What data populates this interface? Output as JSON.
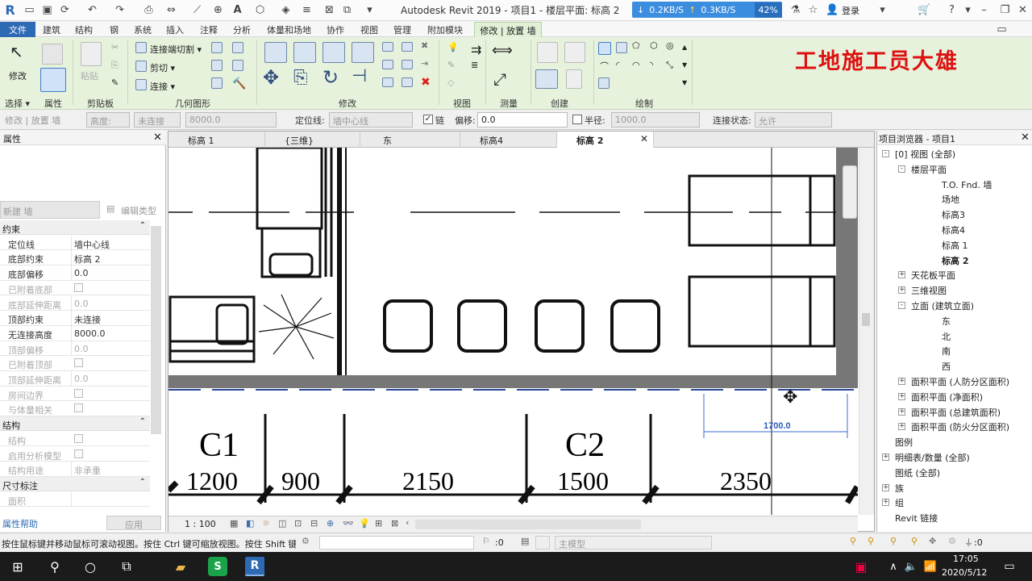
{
  "title_bar": {
    "title": "Autodesk Revit 2019 - 项目1 - 楼层平面: 标高 2",
    "net_down": "0.2KB/S",
    "net_up": "0.3KB/S",
    "net_pct": "42%",
    "login": "登录"
  },
  "menu": {
    "file": "文件",
    "items": [
      "建筑",
      "结构",
      "钢",
      "系统",
      "插入",
      "注释",
      "分析",
      "体量和场地",
      "协作",
      "视图",
      "管理",
      "附加模块",
      "修改 | 放置 墙"
    ]
  },
  "ribbon": {
    "watermark": "工地施工员大雄",
    "modify": "修改",
    "select": "选择 ▾",
    "properties": "属性",
    "paste": "粘贴",
    "clipboard": "剪贴板",
    "join_cut": "连接端切割 ▾",
    "cut": "剪切 ▾",
    "join": "连接 ▾",
    "geometry": "几何图形",
    "modify_panel": "修改",
    "view_panel": "视图",
    "measure_panel": "测量",
    "create_panel": "创建",
    "draw_panel": "绘制"
  },
  "options": {
    "label1": "修改 | 放置 墙",
    "height": "高度:",
    "unconnected": "未连接",
    "height_value": "8000.0",
    "locline_label": "定位线:",
    "locline_value": "墙中心线",
    "chain_label": "链",
    "offset_label": "偏移:",
    "offset_value": "0.0",
    "radius_label": "半径:",
    "radius_value": "1000.0",
    "join_status_label": "连接状态:",
    "join_status_value": "允许"
  },
  "properties": {
    "title": "属性",
    "type_selector": "新建 墙",
    "edit_type": "编辑类型",
    "sections": [
      {
        "name": "约束",
        "rows": [
          {
            "k": "定位线",
            "v": "墙中心线",
            "dis": false
          },
          {
            "k": "底部约束",
            "v": "标高 2",
            "dis": false
          },
          {
            "k": "底部偏移",
            "v": "0.0",
            "dis": false
          },
          {
            "k": "已附着底部",
            "v": "",
            "dis": true,
            "cb": true
          },
          {
            "k": "底部延伸距离",
            "v": "0.0",
            "dis": true
          },
          {
            "k": "顶部约束",
            "v": "未连接",
            "dis": false
          },
          {
            "k": "无连接高度",
            "v": "8000.0",
            "dis": false
          },
          {
            "k": "顶部偏移",
            "v": "0.0",
            "dis": true
          },
          {
            "k": "已附着顶部",
            "v": "",
            "dis": true,
            "cb": true
          },
          {
            "k": "顶部延伸距离",
            "v": "0.0",
            "dis": true
          },
          {
            "k": "房间边界",
            "v": "",
            "dis": true,
            "cb": true
          },
          {
            "k": "与体量相关",
            "v": "",
            "dis": true,
            "cb": true
          }
        ]
      },
      {
        "name": "结构",
        "rows": [
          {
            "k": "结构",
            "v": "",
            "dis": true,
            "cb": true
          },
          {
            "k": "启用分析模型",
            "v": "",
            "dis": true,
            "cb": true
          },
          {
            "k": "结构用途",
            "v": "非承重",
            "dis": true
          }
        ]
      },
      {
        "name": "尺寸标注",
        "rows": [
          {
            "k": "面积",
            "v": "",
            "dis": true
          }
        ]
      }
    ],
    "help": "属性帮助",
    "apply": "应用"
  },
  "view_tabs": [
    "标高 1",
    "{三维}",
    "东",
    "标高4",
    "标高 2"
  ],
  "drawing": {
    "tags": [
      "C1",
      "C2"
    ],
    "dims": [
      "1200",
      "900",
      "2150",
      "1500",
      "2350"
    ],
    "temp_dim": "1700.0"
  },
  "view_control": {
    "scale": "1 : 100"
  },
  "browser": {
    "title": "项目浏览器 - 项目1",
    "nodes": [
      {
        "t": "[0] 视图 (全部)",
        "lvl": 0,
        "tog": "-"
      },
      {
        "t": "楼层平面",
        "lvl": 1,
        "tog": "-"
      },
      {
        "t": "T.O. Fnd. 墙",
        "lvl": 2
      },
      {
        "t": "场地",
        "lvl": 2
      },
      {
        "t": "标高3",
        "lvl": 2
      },
      {
        "t": "标高4",
        "lvl": 2
      },
      {
        "t": "标高 1",
        "lvl": 2
      },
      {
        "t": "标高 2",
        "lvl": 2,
        "bold": true
      },
      {
        "t": "天花板平面",
        "lvl": 1,
        "tog": "+"
      },
      {
        "t": "三维视图",
        "lvl": 1,
        "tog": "+"
      },
      {
        "t": "立面 (建筑立面)",
        "lvl": 1,
        "tog": "-"
      },
      {
        "t": "东",
        "lvl": 2
      },
      {
        "t": "北",
        "lvl": 2
      },
      {
        "t": "南",
        "lvl": 2
      },
      {
        "t": "西",
        "lvl": 2
      },
      {
        "t": "面积平面 (人防分区面积)",
        "lvl": 1,
        "tog": "+"
      },
      {
        "t": "面积平面 (净面积)",
        "lvl": 1,
        "tog": "+"
      },
      {
        "t": "面积平面 (总建筑面积)",
        "lvl": 1,
        "tog": "+"
      },
      {
        "t": "面积平面 (防火分区面积)",
        "lvl": 1,
        "tog": "+"
      },
      {
        "t": "图例",
        "lvl": 0
      },
      {
        "t": "明细表/数量 (全部)",
        "lvl": 0,
        "tog": "+"
      },
      {
        "t": "图纸 (全部)",
        "lvl": 0
      },
      {
        "t": "族",
        "lvl": 0,
        "tog": "+"
      },
      {
        "t": "组",
        "lvl": 0,
        "tog": "+"
      },
      {
        "t": "Revit 链接",
        "lvl": 0
      }
    ]
  },
  "status": {
    "hint": "按住鼠标键并移动鼠标可滚动视图。按住 Ctrl 键可缩放视图。按住 Shift 键",
    "count": ":0",
    "model": "主模型",
    "filter": ":0"
  },
  "taskbar": {
    "time": "17:05",
    "date": "2020/5/12"
  }
}
